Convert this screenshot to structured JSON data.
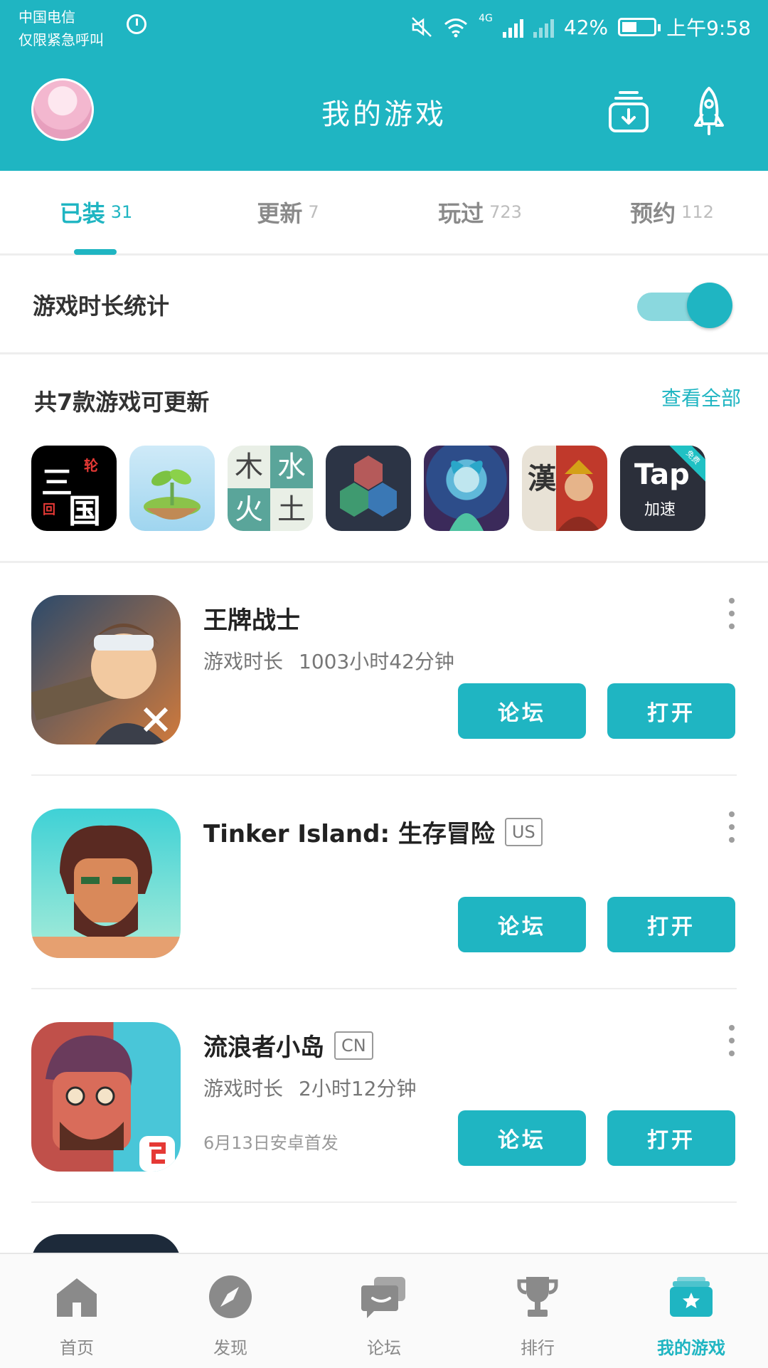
{
  "status_bar": {
    "carrier_line1": "中国电信",
    "carrier_line2": "仅限紧急呼叫",
    "network": "4G",
    "battery": "42%",
    "time": "上午9:58"
  },
  "app_bar": {
    "title": "我的游戏",
    "icons": [
      "avatar",
      "download-manager-icon",
      "rocket-icon"
    ]
  },
  "tabs": [
    {
      "label": "已装",
      "count": "31",
      "active": true
    },
    {
      "label": "更新",
      "count": "7",
      "active": false
    },
    {
      "label": "玩过",
      "count": "723",
      "active": false
    },
    {
      "label": "预约",
      "count": "112",
      "active": false
    }
  ],
  "playtime_stats": {
    "label": "游戏时长统计",
    "enabled": true
  },
  "updates": {
    "title": "共7款游戏可更新",
    "view_all": "查看全部",
    "icon_texts": {
      "sanguo_top": "三",
      "sanguo_corner": "轮",
      "sanguo_bottom": "国",
      "sanguo_small": "回",
      "wuxing": [
        "木",
        "水",
        "火",
        "土"
      ],
      "han": "漢",
      "tap_main": "Tap",
      "tap_sub": "加速",
      "tap_badge": "免费"
    }
  },
  "games": [
    {
      "name": "王牌战士",
      "region": "",
      "playtime_label": "游戏时长",
      "playtime_value": "1003小时42分钟",
      "release": "",
      "forum_label": "论坛",
      "open_label": "打开"
    },
    {
      "name": "Tinker Island: 生存冒险",
      "region": "US",
      "playtime_label": "",
      "playtime_value": "",
      "release": "",
      "forum_label": "论坛",
      "open_label": "打开"
    },
    {
      "name": "流浪者小岛",
      "region": "CN",
      "playtime_label": "游戏时长",
      "playtime_value": "2小时12分钟",
      "release": "6月13日安卓首发",
      "forum_label": "论坛",
      "open_label": "打开"
    }
  ],
  "bottom_nav": [
    {
      "label": "首页",
      "icon": "home-icon",
      "active": false
    },
    {
      "label": "发现",
      "icon": "compass-icon",
      "active": false
    },
    {
      "label": "论坛",
      "icon": "chat-icon",
      "active": false
    },
    {
      "label": "排行",
      "icon": "trophy-icon",
      "active": false
    },
    {
      "label": "我的游戏",
      "icon": "my-games-icon",
      "active": true
    }
  ],
  "colors": {
    "accent": "#1fb5c2",
    "toggle_track": "#8ad8de"
  }
}
